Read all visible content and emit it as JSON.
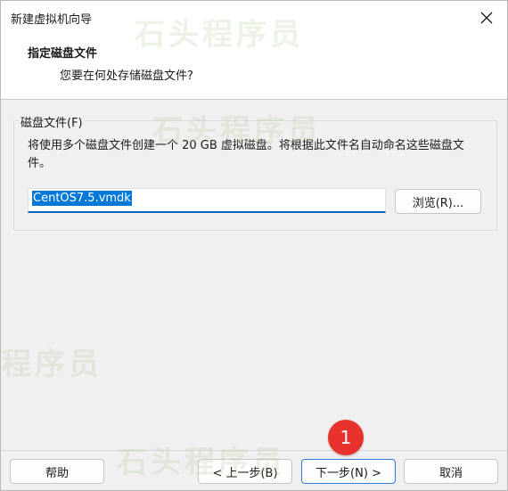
{
  "window": {
    "title": "新建虚拟机向导"
  },
  "header": {
    "title": "指定磁盘文件",
    "subtitle": "您要在何处存储磁盘文件?"
  },
  "disk_file": {
    "group_label": "磁盘文件(F)",
    "description": "将使用多个磁盘文件创建一个 20 GB 虚拟磁盘。将根据此文件名自动命名这些磁盘文件。",
    "file_name": "CentOS7.5.vmdk",
    "browse_label": "浏览(R)..."
  },
  "footer": {
    "help_label": "帮助",
    "back_label": "< 上一步(B)",
    "next_label": "下一步(N) >",
    "cancel_label": "取消"
  },
  "annotation": {
    "step_number": "1",
    "color": "#e8322d"
  },
  "watermark": {
    "text_1": "石头程序员",
    "text_2": "石头程序员",
    "text_3": "程序员",
    "text_4": "石头程序员"
  },
  "colors": {
    "accent": "#0078d7",
    "background": "#f0f0f0"
  }
}
